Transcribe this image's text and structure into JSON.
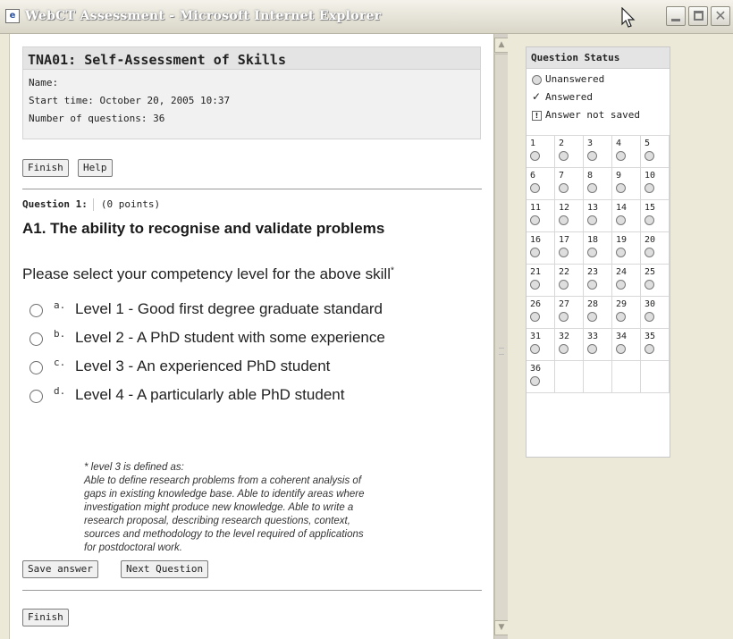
{
  "window": {
    "title": "WebCT Assessment - Microsoft Internet Explorer"
  },
  "assessment": {
    "title": "TNA01: Self-Assessment of Skills",
    "name_line": "Name:",
    "start_time_line": "Start time: October 20, 2005 10:37",
    "num_questions_line": "Number of questions: 36"
  },
  "buttons": {
    "finish_top": "Finish",
    "help": "Help",
    "save_answer": "Save answer",
    "next_question": "Next Question",
    "finish_bottom": "Finish"
  },
  "question": {
    "number_label": "Question 1:",
    "points": "(0 points)",
    "title": "A1. The ability to recognise and validate problems",
    "prompt": "Please select your competency level for the above skill",
    "prompt_marker": "*",
    "options": [
      {
        "letter": "a.",
        "label": "Level 1 - Good first degree graduate standard",
        "selected": false
      },
      {
        "letter": "b.",
        "label": "Level 2 - A PhD student with some experience",
        "selected": false
      },
      {
        "letter": "c.",
        "label": "Level 3 - An experienced PhD student",
        "selected": false
      },
      {
        "letter": "d.",
        "label": "Level 4 - A particularly able PhD student",
        "selected": false
      }
    ],
    "note_lines": [
      "* level 3 is defined as:",
      "Able to define research problems from a coherent analysis of",
      "gaps in existing knowledge base. Able to identify areas where",
      "investigation might produce new knowledge. Able to write a",
      "research proposal, describing research questions, context,",
      "sources and methodology to the level required of applications",
      "for postdoctoral work."
    ]
  },
  "status_panel": {
    "title": "Question Status",
    "legend": [
      {
        "icon": "circle-icon",
        "label": "Unanswered"
      },
      {
        "icon": "check-icon",
        "label": "Answered"
      },
      {
        "icon": "warning-box-icon",
        "label": "Answer not saved"
      }
    ],
    "questions": [
      "1",
      "2",
      "3",
      "4",
      "5",
      "6",
      "7",
      "8",
      "9",
      "10",
      "11",
      "12",
      "13",
      "14",
      "15",
      "16",
      "17",
      "18",
      "19",
      "20",
      "21",
      "22",
      "23",
      "24",
      "25",
      "26",
      "27",
      "28",
      "29",
      "30",
      "31",
      "32",
      "33",
      "34",
      "35",
      "36"
    ]
  }
}
